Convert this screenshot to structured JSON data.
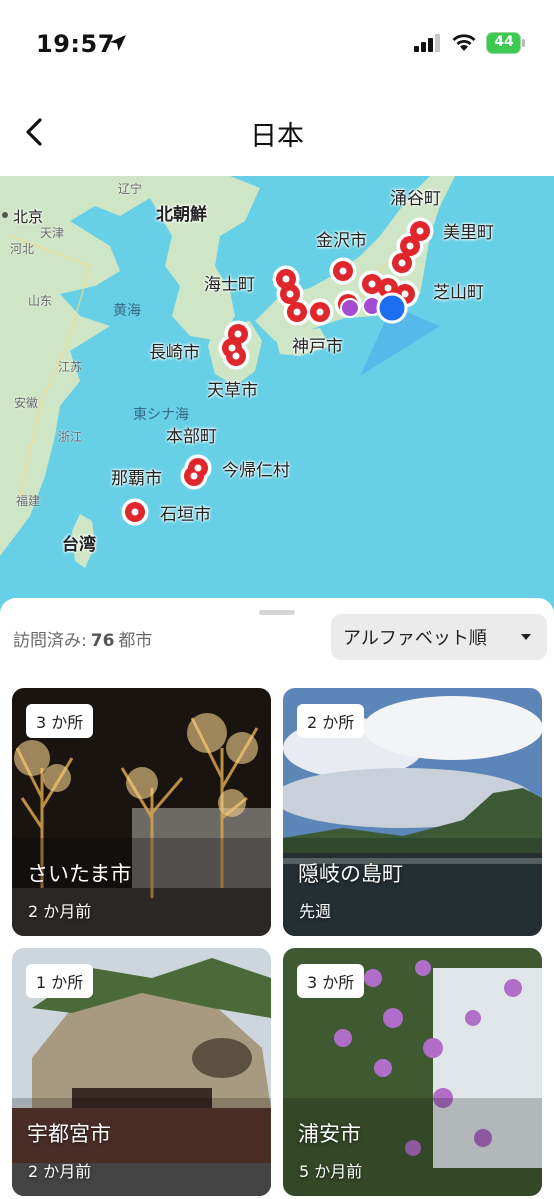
{
  "status_bar": {
    "time": "19:57",
    "battery": "44"
  },
  "header": {
    "title": "日本"
  },
  "map": {
    "labels": {
      "liaoning": "辽宁",
      "beijing": "北京",
      "north_korea": "北朝鮮",
      "hebei": "河北",
      "tianjin": "天津",
      "shandong": "山东",
      "yellow_sea": "黄海",
      "jiangsu": "江苏",
      "anhui": "安徽",
      "zhejiang": "浙江",
      "fujian": "福建",
      "taiwan": "台湾",
      "east_china_sea": "東シナ海",
      "wakuya": "涌谷町",
      "misato": "美里町",
      "kanazawa": "金沢市",
      "shibayama": "芝山町",
      "ama": "海士町",
      "kobe": "神戸市",
      "nagasaki": "長崎市",
      "amakusa": "天草市",
      "motobu": "本部町",
      "naha": "那覇市",
      "nakijin": "今帰仁村",
      "ishigaki": "石垣市"
    }
  },
  "summary": {
    "visited_label": "訪問済み:",
    "visited_count": "76",
    "visited_unit": "都市"
  },
  "sort": {
    "label": "アルファベット順"
  },
  "cards": [
    {
      "badge": "3 か所",
      "city": "さいたま市",
      "when": "2 か月前"
    },
    {
      "badge": "2 か所",
      "city": "隠岐の島町",
      "when": "先週"
    },
    {
      "badge": "1 か所",
      "city": "宇都宮市",
      "when": "2 か月前"
    },
    {
      "badge": "3 か所",
      "city": "浦安市",
      "when": "5 か月前"
    }
  ],
  "colors": {
    "pin_red": "#e0262d",
    "user_blue": "#1e6ff0",
    "sea": "#67d0e6",
    "land": "#cfe6c6"
  }
}
